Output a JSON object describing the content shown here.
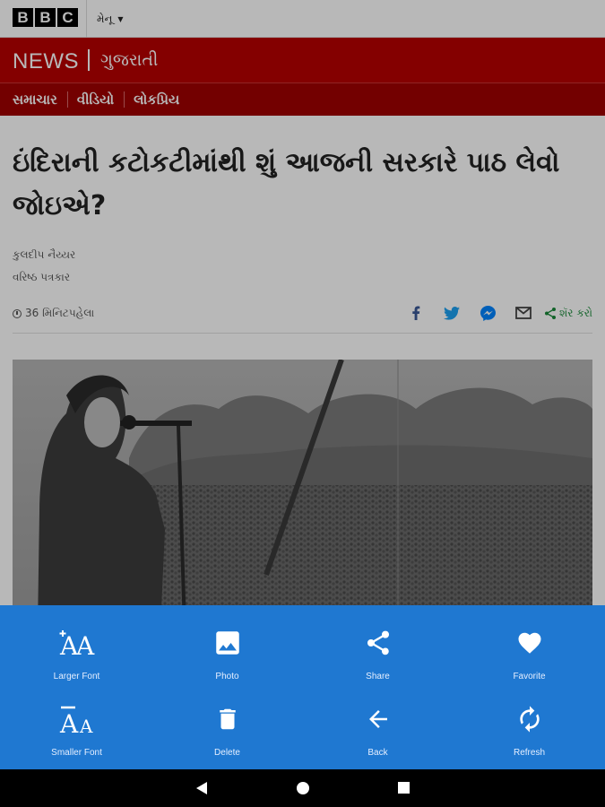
{
  "header": {
    "logo_letters": [
      "B",
      "B",
      "C"
    ],
    "menu_label": "મેનૂ"
  },
  "newsbar": {
    "brand": "NEWS",
    "language": "ગુજરાતી"
  },
  "nav": {
    "items": [
      "સમાચાર",
      "વીડિયો",
      "લોકપ્રિય"
    ]
  },
  "article": {
    "headline": "ઇંદિરાની કટોકટીમાંથી શું આજની સરકારે પાઠ લેવો જોઇએ?",
    "author_name": "કુલદીપ નૈય્યર",
    "author_role": "વરિષ્ઠ પત્રકાર",
    "timestamp": "36 મિનિટપહેલા",
    "share_label": "શૅર કરો",
    "share_icons": [
      "facebook-icon",
      "twitter-icon",
      "messenger-icon",
      "email-icon",
      "share-icon"
    ]
  },
  "actions": [
    {
      "label": "Larger Font",
      "icon": "larger-font-icon"
    },
    {
      "label": "Photo",
      "icon": "photo-icon"
    },
    {
      "label": "Share",
      "icon": "share-icon"
    },
    {
      "label": "Favorite",
      "icon": "heart-icon"
    },
    {
      "label": "Smaller Font",
      "icon": "smaller-font-icon"
    },
    {
      "label": "Delete",
      "icon": "trash-icon"
    },
    {
      "label": "Back",
      "icon": "arrow-left-icon"
    },
    {
      "label": "Refresh",
      "icon": "refresh-icon"
    }
  ],
  "colors": {
    "bbc_red": "#b80000",
    "sheet_blue": "#1f78d1",
    "share_green": "#1a8a3a"
  }
}
